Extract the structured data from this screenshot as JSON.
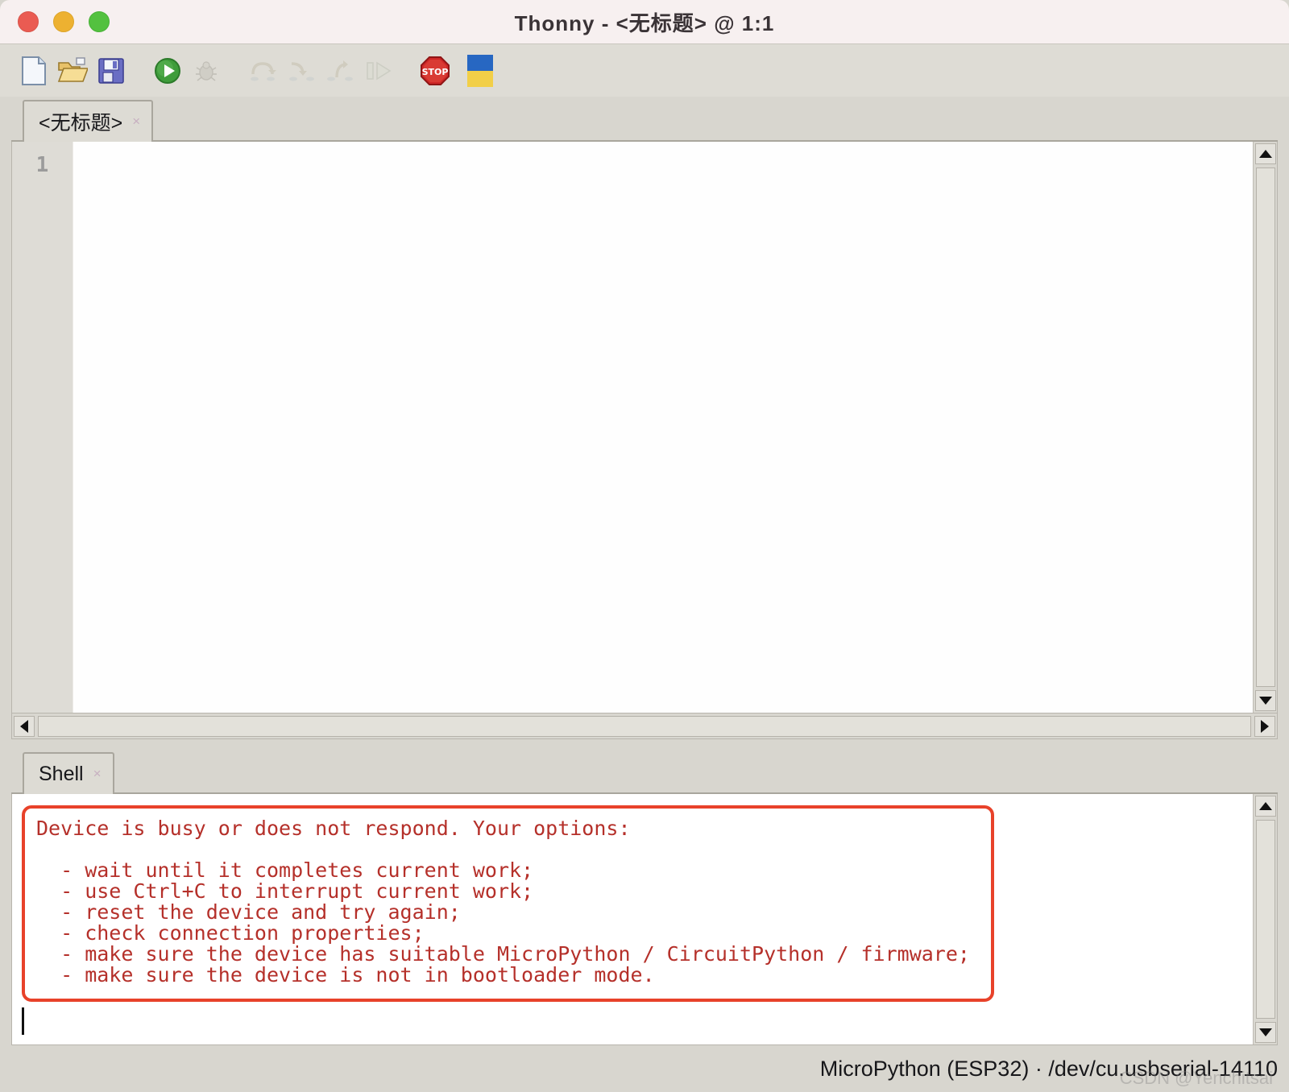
{
  "window": {
    "title": "Thonny - <无标题> @ 1:1",
    "controls": [
      "close",
      "minimize",
      "zoom"
    ]
  },
  "toolbar": {
    "buttons": [
      {
        "name": "new-file",
        "icon": "new-file-icon",
        "enabled": true
      },
      {
        "name": "open-file",
        "icon": "open-folder-icon",
        "enabled": true
      },
      {
        "name": "save-file",
        "icon": "floppy-save-icon",
        "enabled": true
      },
      {
        "name": "run",
        "icon": "green-play-icon",
        "enabled": true
      },
      {
        "name": "debug",
        "icon": "bug-icon",
        "enabled": false
      },
      {
        "name": "step-over",
        "icon": "step-over-arrow-icon",
        "enabled": false
      },
      {
        "name": "step-into",
        "icon": "step-into-arrow-icon",
        "enabled": false
      },
      {
        "name": "step-out",
        "icon": "step-out-arrow-icon",
        "enabled": false
      },
      {
        "name": "resume",
        "icon": "resume-play-icon",
        "enabled": false
      },
      {
        "name": "stop",
        "icon": "stop-sign-icon",
        "enabled": true
      },
      {
        "name": "support-ukraine",
        "icon": "ukraine-flag-icon",
        "enabled": true
      }
    ]
  },
  "editor": {
    "tab_label": "<无标题>",
    "tab_close": "×",
    "line_numbers": [
      "1"
    ],
    "content": ""
  },
  "shell": {
    "tab_label": "Shell",
    "tab_close": "×",
    "error_lines": [
      "Device is busy or does not respond. Your options:",
      "",
      "  - wait until it completes current work;",
      "  - use Ctrl+C to interrupt current work;",
      "  - reset the device and try again;",
      "  - check connection properties;",
      "  - make sure the device has suitable MicroPython / CircuitPython / firmware;",
      "  - make sure the device is not in bootloader mode."
    ]
  },
  "statusbar": {
    "interpreter": "MicroPython (ESP32)",
    "separator": "·",
    "port": "/dev/cu.usbserial-14110",
    "full": "MicroPython (ESP32)  ·  /dev/cu.usbserial-14110",
    "watermark": "CSDN @Yenchitsai"
  },
  "colors": {
    "titlebar_bg": "#f7f0f0",
    "chrome_bg": "#d8d6cf",
    "error_border": "#e8422a",
    "error_text": "#b5302a",
    "editor_bg": "#fdfdfd"
  }
}
